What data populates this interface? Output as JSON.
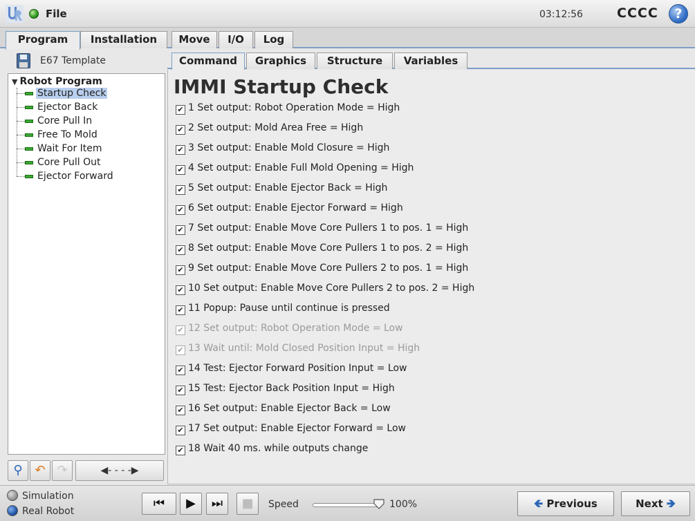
{
  "topbar": {
    "file_label": "File",
    "clock": "03:12:56",
    "robot_name": "CCCC",
    "help_symbol": "?"
  },
  "main_tabs": [
    {
      "label": "Program",
      "active": true
    },
    {
      "label": "Installation",
      "active": false
    },
    {
      "label": "Move",
      "active": false
    },
    {
      "label": "I/O",
      "active": false
    },
    {
      "label": "Log",
      "active": false
    }
  ],
  "program": {
    "name": "E67 Template",
    "tree_root": "Robot Program",
    "tree_items": [
      {
        "label": "Startup Check",
        "selected": true
      },
      {
        "label": "Ejector Back",
        "selected": false
      },
      {
        "label": "Core Pull In",
        "selected": false
      },
      {
        "label": "Free To Mold",
        "selected": false
      },
      {
        "label": "Wait For Item",
        "selected": false
      },
      {
        "label": "Core Pull Out",
        "selected": false
      },
      {
        "label": "Ejector Forward",
        "selected": false
      }
    ]
  },
  "sub_tabs": [
    {
      "label": "Command",
      "active": true
    },
    {
      "label": "Graphics",
      "active": false
    },
    {
      "label": "Structure",
      "active": false
    },
    {
      "label": "Variables",
      "active": false
    }
  ],
  "content": {
    "title": "IMMI Startup Check",
    "commands": [
      {
        "text": "1 Set output: Robot Operation Mode = High",
        "checked": true,
        "enabled": true
      },
      {
        "text": "2 Set output: Mold Area Free = High",
        "checked": true,
        "enabled": true
      },
      {
        "text": "3 Set output: Enable Mold Closure = High",
        "checked": true,
        "enabled": true
      },
      {
        "text": "4 Set output: Enable Full Mold Opening = High",
        "checked": true,
        "enabled": true
      },
      {
        "text": "5 Set output: Enable Ejector Back = High",
        "checked": true,
        "enabled": true
      },
      {
        "text": "6 Set output: Enable Ejector Forward = High",
        "checked": true,
        "enabled": true
      },
      {
        "text": "7 Set output: Enable Move Core Pullers 1 to pos. 1 = High",
        "checked": true,
        "enabled": true
      },
      {
        "text": "8 Set output: Enable Move Core Pullers 1 to pos. 2 = High",
        "checked": true,
        "enabled": true
      },
      {
        "text": "9 Set output: Enable Move Core Pullers 2 to pos. 1 = High",
        "checked": true,
        "enabled": true
      },
      {
        "text": "10 Set output: Enable Move Core Pullers 2 to pos. 2 = High",
        "checked": true,
        "enabled": true
      },
      {
        "text": "11 Popup: Pause until continue is pressed",
        "checked": true,
        "enabled": true
      },
      {
        "text": "12 Set output: Robot Operation Mode = Low",
        "checked": true,
        "enabled": false
      },
      {
        "text": "13 Wait until: Mold Closed Position Input = High",
        "checked": true,
        "enabled": false
      },
      {
        "text": "14 Test: Ejector Forward Position Input = Low",
        "checked": true,
        "enabled": true
      },
      {
        "text": "15 Test: Ejector Back Position Input = High",
        "checked": true,
        "enabled": true
      },
      {
        "text": "16 Set output: Enable Ejector Back = Low",
        "checked": true,
        "enabled": true
      },
      {
        "text": "17 Set output: Enable Ejector Forward = Low",
        "checked": true,
        "enabled": true
      },
      {
        "text": "18 Wait 40 ms. while outputs change",
        "checked": true,
        "enabled": true
      }
    ]
  },
  "footer": {
    "simulation_label": "Simulation",
    "real_robot_label": "Real Robot",
    "speed_label": "Speed",
    "speed_value": "100%",
    "speed_fraction": 1.0,
    "previous_label": "Previous",
    "next_label": "Next"
  },
  "colors": {
    "accent": "#7d9ec6",
    "selection": "#b9cfee",
    "status_ok": "#2e9b1f",
    "icon_blue": "#2b66b8"
  }
}
